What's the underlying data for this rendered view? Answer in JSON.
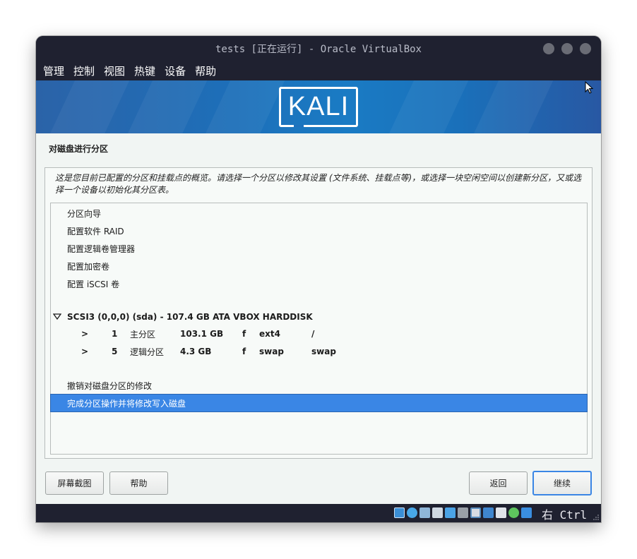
{
  "window": {
    "title": "tests [正在运行] - Oracle VirtualBox"
  },
  "menu": [
    "管理",
    "控制",
    "视图",
    "热键",
    "设备",
    "帮助"
  ],
  "banner": {
    "logo_text": "KALI"
  },
  "installer": {
    "page_title": "对磁盘进行分区",
    "description": "这是您目前已配置的分区和挂载点的概览。请选择一个分区以修改其设置 (文件系统、挂载点等)，或选择一块空闲空间以创建新分区，又或选择一个设备以初始化其分区表。",
    "menu_items": [
      "分区向导",
      "配置软件 RAID",
      "配置逻辑卷管理器",
      "配置加密卷",
      "配置 iSCSI 卷"
    ],
    "disk": {
      "expander": "▽",
      "label": "SCSI3 (0,0,0) (sda) - 107.4 GB ATA VBOX HARDDISK"
    },
    "partitions": [
      {
        "arrow": ">",
        "number": "1",
        "type": "主分区",
        "size": "103.1 GB",
        "flag": "f",
        "fs": "ext4",
        "mount": "/"
      },
      {
        "arrow": ">",
        "number": "5",
        "type": "逻辑分区",
        "size": "4.3 GB",
        "flag": "f",
        "fs": "swap",
        "mount": "swap"
      }
    ],
    "undo_label": "撤销对磁盘分区的修改",
    "finish_label": "完成分区操作并将修改写入磁盘",
    "buttons": {
      "screenshot": "屏幕截图",
      "help": "帮助",
      "back": "返回",
      "continue": "继续"
    }
  },
  "statusbar": {
    "host_key": "右 Ctrl",
    "tray_icons": [
      "hard-disk-icon",
      "optical-drive-icon",
      "audio-icon",
      "network-icon",
      "usb-icon",
      "shared-folder-icon",
      "display-icon",
      "recording-icon",
      "cpu-icon",
      "mouse-integration-icon",
      "keyboard-capture-icon"
    ]
  },
  "colors": {
    "selection": "#3a86e5",
    "host_chrome": "#1f2130",
    "banner": "#1a7bc4"
  }
}
